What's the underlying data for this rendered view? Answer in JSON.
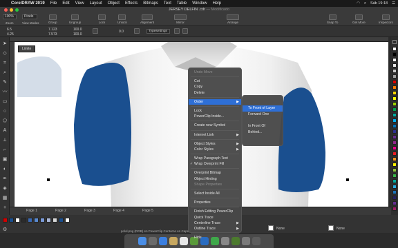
{
  "menubar": {
    "app_name": "CorelDRAW 2019",
    "items": [
      "File",
      "Edit",
      "View",
      "Layout",
      "Object",
      "Effects",
      "Bitmaps",
      "Text",
      "Table",
      "Window",
      "Help"
    ],
    "clock": "Sáb 19:18"
  },
  "window": {
    "title": "JERSEY DELFIN .cdr",
    "title_suffix": "— Modificado"
  },
  "toolbar": {
    "zoom_value": "100%",
    "units_value": "Pixels",
    "groups": [
      {
        "label": "Zoom"
      },
      {
        "label": "View Modes"
      },
      {
        "label": "Group"
      },
      {
        "label": "Ungroup"
      },
      {
        "label": "Lock"
      },
      {
        "label": "Unlock"
      },
      {
        "label": "Alignment"
      },
      {
        "label": "Mirror"
      },
      {
        "label": "Arrange"
      },
      {
        "label": "Snap To"
      },
      {
        "label": "Get More"
      },
      {
        "label": "Inspectors"
      }
    ]
  },
  "propbar": {
    "x": "6.5",
    "y": "4.25",
    "w": "7.123",
    "h": "7.573",
    "scale_w": "100.0",
    "scale_h": "100.0",
    "angle": "0.0",
    "font_dropdown": "Typesettings"
  },
  "canvas": {
    "shirt_color": "#1a4f8f",
    "thumbnail_label": "Limite"
  },
  "context_menu": {
    "items": [
      {
        "label": "Undo Move",
        "disabled": true
      },
      {
        "sep": true
      },
      {
        "label": "Cut"
      },
      {
        "label": "Copy"
      },
      {
        "label": "Delete"
      },
      {
        "sep": true
      },
      {
        "label": "Order",
        "submenu": true,
        "active": true
      },
      {
        "sep": true
      },
      {
        "label": "Lock"
      },
      {
        "label": "PowerClip Inside..."
      },
      {
        "sep": true
      },
      {
        "label": "Create new Symbol"
      },
      {
        "sep": true
      },
      {
        "label": "Internet Link",
        "submenu": true
      },
      {
        "sep": true
      },
      {
        "label": "Object Styles",
        "submenu": true
      },
      {
        "label": "Color Styles",
        "submenu": true
      },
      {
        "sep": true
      },
      {
        "label": "Wrap Paragraph Text"
      },
      {
        "label": "Wrap Overprint Fill",
        "checked": true
      },
      {
        "sep": true
      },
      {
        "label": "Overprint Bitmap"
      },
      {
        "label": "Object Hinting"
      },
      {
        "label": "Shape Properties",
        "disabled": true
      },
      {
        "sep": true
      },
      {
        "label": "Select Inside All"
      },
      {
        "sep": true
      },
      {
        "label": "Properties"
      },
      {
        "sep": true
      },
      {
        "label": "Finish Editing PowerClip"
      },
      {
        "label": "Quick Trace"
      },
      {
        "label": "Centerline Trace",
        "submenu": true
      },
      {
        "label": "Outline Trace",
        "submenu": true
      },
      {
        "sep": true
      },
      {
        "label": "Hide"
      }
    ],
    "order_submenu": [
      "To Front of Layer",
      "Forward One",
      "In Front Of",
      "Behind..."
    ]
  },
  "pages": [
    "Page 1",
    "Page 2",
    "Page 3",
    "Page 4",
    "Page 5"
  ],
  "status": {
    "message": "polol.png (RGB) en PowerClip Contorno en Capa 1",
    "fill_label": "None",
    "outline_label": "None"
  },
  "palette_colors": [
    "#ffffff",
    "#000000",
    "#f5f5f5",
    "#e6e6e6",
    "#c8c8c8",
    "#a0a0a0",
    "#e10000",
    "#ff7a00",
    "#ffd400",
    "#ffff00",
    "#9cd000",
    "#00a64f",
    "#00a9a0",
    "#00aeef",
    "#0072bc",
    "#2e3192",
    "#662d91",
    "#92278f",
    "#ec008c",
    "#ed1c24",
    "#f7941d",
    "#fff200",
    "#8dc63f",
    "#39b54a",
    "#00a99d",
    "#27aae1",
    "#1c75bc",
    "#262262",
    "#662d91",
    "#9e1f63"
  ],
  "doc_colors": [
    "#d10000",
    "#1a4f8f",
    "#ffffff",
    "#2b2b2b",
    "#3a6ab5",
    "#5a8ad0",
    "#7a9ad8",
    "#aab8d8",
    "#d8d8d8",
    "#1a4f8f",
    "#ffffff"
  ]
}
